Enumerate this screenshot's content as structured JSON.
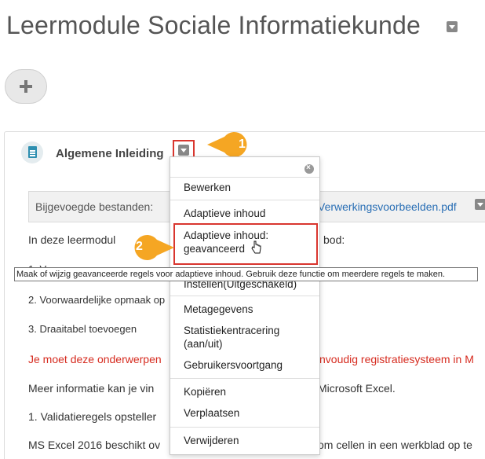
{
  "page": {
    "title": "Leermodule Sociale Informatiekunde"
  },
  "section": {
    "title": "Algemene Inleiding"
  },
  "callouts": {
    "first": "1",
    "second": "2"
  },
  "attachments": {
    "label": "Bijgevoegde bestanden:",
    "file_link": "Verwerkingsvoorbeelden.pdf"
  },
  "content": {
    "intro_left": "In deze leermodul",
    "intro_right": "bod:",
    "item1": "1. Va",
    "item2": "2. Voorwaardelijke opmaak op",
    "item3": "3. Draaitabel toevoegen",
    "warning_left": "Je moet deze onderwerpen",
    "warning_right": "nvoudig registratiesysteem in M",
    "more_left": "Meer informatie kan je vin",
    "more_right": "Microsoft Excel.",
    "validation_left": "1. Validatieregels opsteller",
    "ms_left": "MS Excel 2016 beschikt ov",
    "ms_right": "om cellen in een werkblad op te"
  },
  "tooltip": {
    "text": "Maak of wijzig geavanceerde regels voor adaptieve inhoud. Gebruik deze functie om meerdere regels te maken."
  },
  "menu": {
    "edit": "Bewerken",
    "adaptive": "Adaptieve inhoud",
    "adaptive_advanced_line1": "Adaptieve inhoud:",
    "adaptive_advanced_line2": "geavanceerd",
    "settings_partial": "Instellen(Uitgeschakeld)",
    "metadata": "Metagegevens",
    "stats_line1": "Statistiekentracering",
    "stats_line2": "(aan/uit)",
    "user_progress": "Gebruikersvoortgang",
    "copy": "Kopiëren",
    "move": "Verplaatsen",
    "delete": "Verwijderen"
  },
  "colors": {
    "accent_red": "#d9362f",
    "callout_orange": "#f5a623",
    "link_blue": "#2a6fb5",
    "warning_red": "#d62b1f"
  }
}
